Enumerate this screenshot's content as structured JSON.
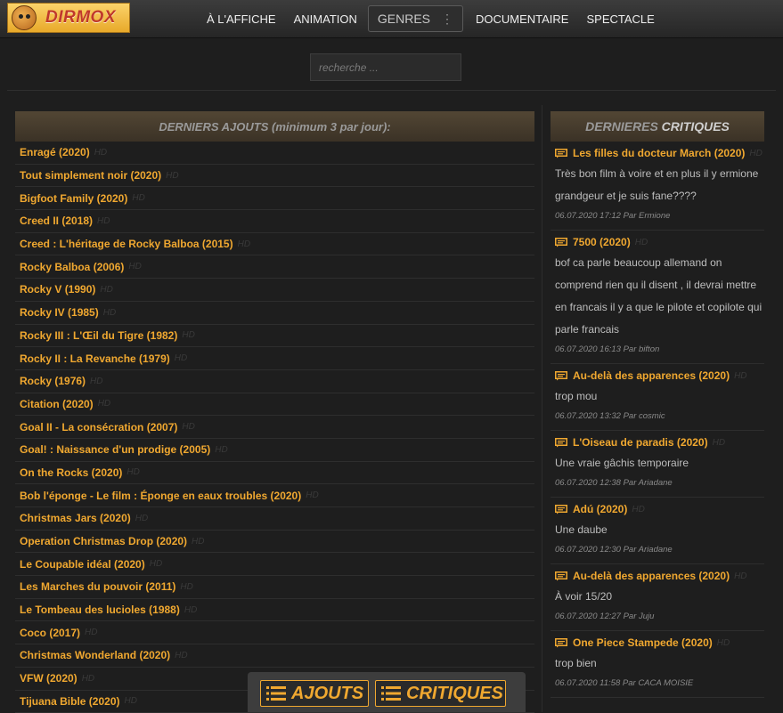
{
  "logo": {
    "text": "DIRMOX"
  },
  "nav": {
    "items": [
      "À L'AFFICHE",
      "ANIMATION"
    ],
    "genres": "GENRES",
    "items_after": [
      "DOCUMENTAIRE",
      "SPECTACLE"
    ]
  },
  "search": {
    "placeholder": "recherche ..."
  },
  "ajouts": {
    "heading_main": "DERNIERS AJOUTS",
    "heading_sub": "(minimum 3 par jour):",
    "hd_label": "HD",
    "items": [
      "Enragé (2020)",
      "Tout simplement noir (2020)",
      "Bigfoot Family (2020)",
      "Creed II (2018)",
      "Creed : L'héritage de Rocky Balboa (2015)",
      "Rocky Balboa (2006)",
      "Rocky V (1990)",
      "Rocky IV (1985)",
      "Rocky III : L'Œil du Tigre (1982)",
      "Rocky II : La Revanche (1979)",
      "Rocky (1976)",
      "Citation (2020)",
      "Goal II - La consécration (2007)",
      "Goal! : Naissance d'un prodige (2005)",
      "On the Rocks (2020)",
      "Bob l'éponge - Le film : Éponge en eaux troubles (2020)",
      "Christmas Jars (2020)",
      "Operation Christmas Drop (2020)",
      "Le Coupable idéal (2020)",
      "Les Marches du pouvoir (2011)",
      "Le Tombeau des lucioles (1988)",
      "Coco (2017)",
      "Christmas Wonderland (2020)",
      "VFW (2020)",
      "Tijuana Bible (2020)"
    ]
  },
  "critiques": {
    "heading_a": "DERNIERES",
    "heading_b": "CRITIQUES",
    "hd_label": "HD",
    "items": [
      {
        "title": "Les filles du docteur March (2020)",
        "text": [
          "Très bon film à voire et en plus il y ermione",
          "grandgeur et je suis fane????"
        ],
        "meta": "06.07.2020 17:12 Par Ermione"
      },
      {
        "title": "7500 (2020)",
        "text": [
          "bof ca parle beaucoup allemand on",
          "comprend rien qu il disent , il devrai mettre",
          "en francais il y a que le pilote et copilote qui",
          "parle francais"
        ],
        "meta": "06.07.2020 16:13 Par bifton"
      },
      {
        "title": "Au-delà des apparences (2020)",
        "text": [
          "trop mou"
        ],
        "meta": "06.07.2020 13:32 Par cosmic"
      },
      {
        "title": "L'Oiseau de paradis (2020)",
        "text": [
          "Une vraie gâchis temporaire"
        ],
        "meta": "06.07.2020 12:38 Par Ariadane"
      },
      {
        "title": "Adú (2020)",
        "text": [
          "Une daube"
        ],
        "meta": "06.07.2020 12:30 Par Ariadane"
      },
      {
        "title": "Au-delà des apparences (2020)",
        "text": [
          "À voir 15/20"
        ],
        "meta": "06.07.2020 12:27 Par Juju"
      },
      {
        "title": "One Piece Stampede (2020)",
        "text": [
          "trop bien"
        ],
        "meta": "06.07.2020 11:58 Par CACA MOISIE"
      }
    ]
  },
  "bottom": {
    "ajouts_label": "AJOUTS",
    "critiques_label": "CRITIQUES"
  },
  "colors": {
    "accent": "#f0a830",
    "background": "#1e1e1e",
    "panel_header": "#4a3f2f"
  },
  "icons": [
    "mascot-logo-icon",
    "kebab-menu-icon",
    "speech-bubble-icon",
    "list-lines-icon"
  ]
}
